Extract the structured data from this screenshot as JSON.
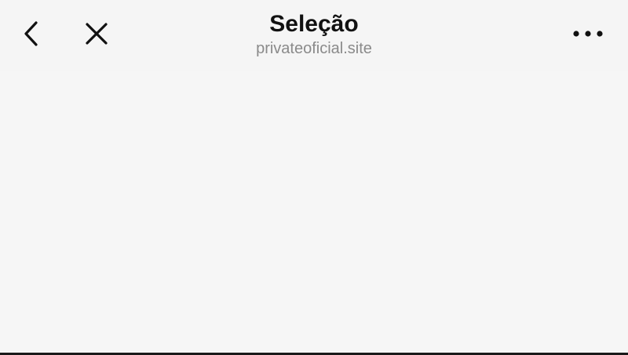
{
  "header": {
    "title": "Seleção",
    "url": "privateoficial.site",
    "icons": {
      "back": "chevron-left-icon",
      "close": "close-icon",
      "more": "more-horizontal-icon"
    }
  },
  "colors": {
    "background": "#f5f5f5",
    "title": "#111111",
    "url": "#8a8a8a",
    "icon": "#111111"
  }
}
